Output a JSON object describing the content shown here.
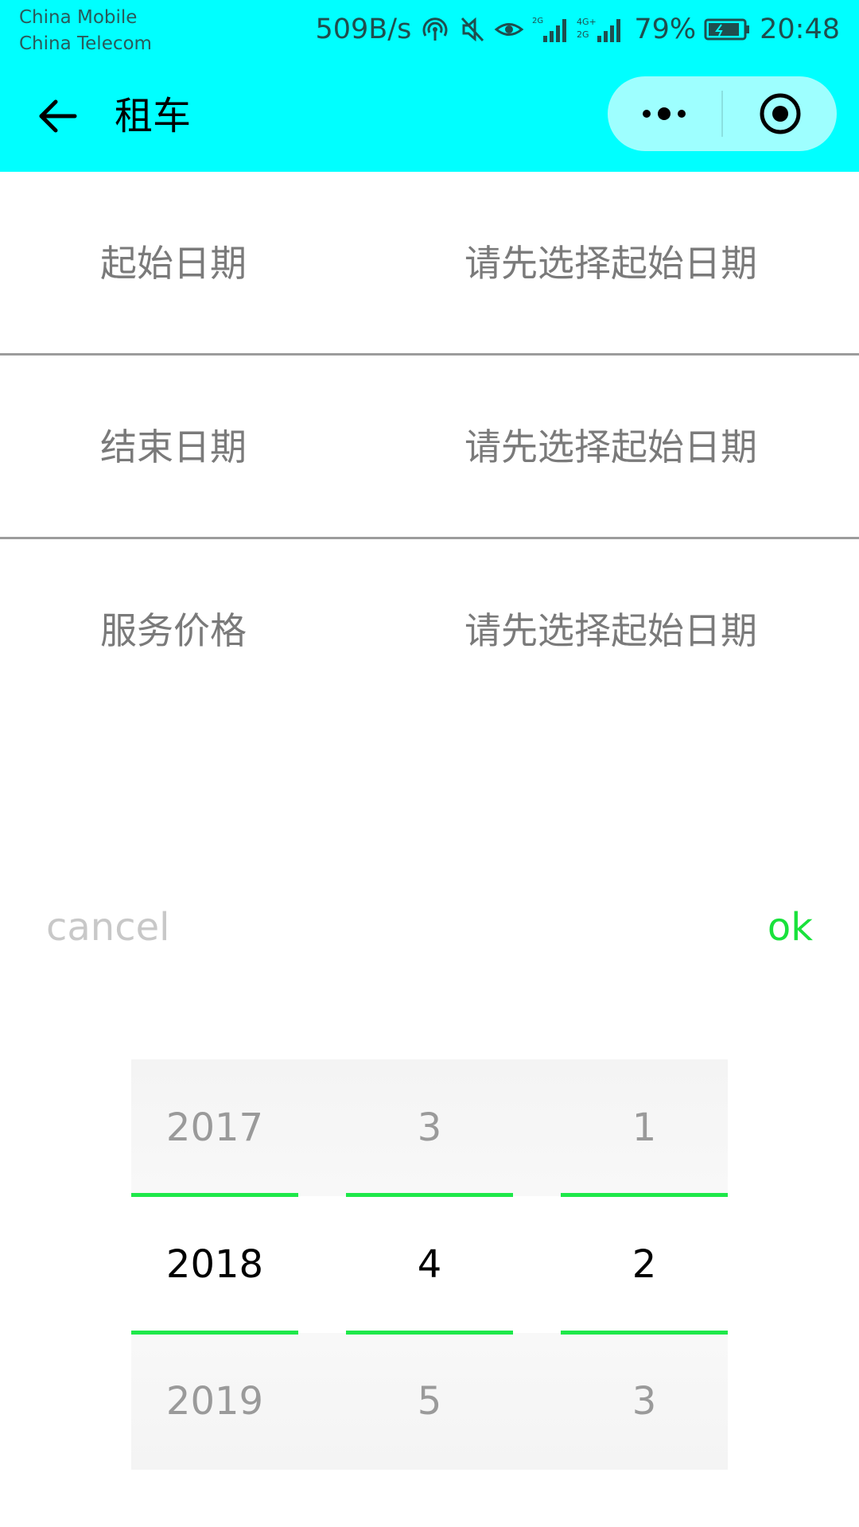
{
  "status_bar": {
    "carrier_1": "China Mobile",
    "carrier_2": "China Telecom",
    "net_speed": "509B/s",
    "battery": "79%",
    "time": "20:48",
    "icons": [
      "hotspot-icon",
      "mute-icon",
      "eye-care-icon",
      "signal-2g-icon",
      "signal-4g-icon",
      "battery-icon"
    ]
  },
  "nav": {
    "title": "租车",
    "back_icon": "arrow-left-icon",
    "more_icon": "more-dots-icon",
    "close_icon": "target-circle-icon"
  },
  "form": {
    "rows": [
      {
        "label": "起始日期",
        "value": "请先选择起始日期"
      },
      {
        "label": "结束日期",
        "value": "请先选择起始日期"
      },
      {
        "label": "服务价格",
        "value": "请先选择起始日期"
      }
    ]
  },
  "picker": {
    "cancel_label": "cancel",
    "ok_label": "ok",
    "columns": [
      {
        "items": [
          "2017",
          "2018",
          "2019"
        ],
        "selected": "2018"
      },
      {
        "items": [
          "3",
          "4",
          "5"
        ],
        "selected": "4"
      },
      {
        "items": [
          "1",
          "2",
          "3"
        ],
        "selected": "2"
      }
    ]
  },
  "colors": {
    "header_bg": "#00ffff",
    "ok": "#19e23c",
    "indicator": "#1ee84a",
    "cancel": "#c8c8c8",
    "row_text": "#7a7a7a"
  }
}
